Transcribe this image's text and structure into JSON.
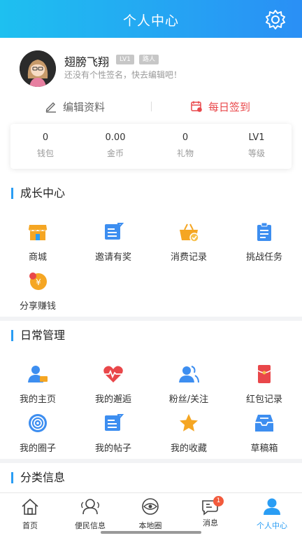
{
  "header": {
    "title": "个人中心"
  },
  "profile": {
    "name": "翅膀飞翔",
    "level_badge": "LV1",
    "role_badge": "路人",
    "signature": "还没有个性签名，快去编辑吧！"
  },
  "actions": {
    "edit": "编辑资料",
    "sign_in": "每日签到"
  },
  "stats": [
    {
      "value": "0",
      "label": "钱包"
    },
    {
      "value": "0.00",
      "label": "金币"
    },
    {
      "value": "0",
      "label": "礼物"
    },
    {
      "value": "LV1",
      "label": "等级"
    }
  ],
  "growth": {
    "title": "成长中心",
    "items": [
      {
        "label": "商城",
        "icon": "shop-icon"
      },
      {
        "label": "邀请有奖",
        "icon": "invite-icon"
      },
      {
        "label": "消费记录",
        "icon": "basket-icon"
      },
      {
        "label": "挑战任务",
        "icon": "clipboard-icon"
      },
      {
        "label": "分享赚钱",
        "icon": "coin-icon"
      }
    ]
  },
  "daily": {
    "title": "日常管理",
    "items": [
      {
        "label": "我的主页",
        "icon": "profile-card-icon"
      },
      {
        "label": "我的邂逅",
        "icon": "heartbeat-icon"
      },
      {
        "label": "粉丝/关注",
        "icon": "fans-icon"
      },
      {
        "label": "红包记录",
        "icon": "red-envelope-icon"
      },
      {
        "label": "我的圈子",
        "icon": "circle-icon"
      },
      {
        "label": "我的帖子",
        "icon": "post-icon"
      },
      {
        "label": "我的收藏",
        "icon": "star-icon"
      },
      {
        "label": "草稿箱",
        "icon": "drafts-icon"
      }
    ]
  },
  "category": {
    "title": "分类信息"
  },
  "tabs": [
    {
      "label": "首页",
      "icon": "home-icon"
    },
    {
      "label": "便民信息",
      "icon": "convenience-icon"
    },
    {
      "label": "本地圈",
      "icon": "local-circle-icon"
    },
    {
      "label": "消息",
      "icon": "message-icon",
      "badge": "1"
    },
    {
      "label": "个人中心",
      "icon": "user-icon",
      "active": true
    }
  ],
  "colors": {
    "accent": "#2a9df4",
    "header_start": "#1ec0f0",
    "header_end": "#2a8ff5",
    "sign_red": "#e9474a"
  }
}
